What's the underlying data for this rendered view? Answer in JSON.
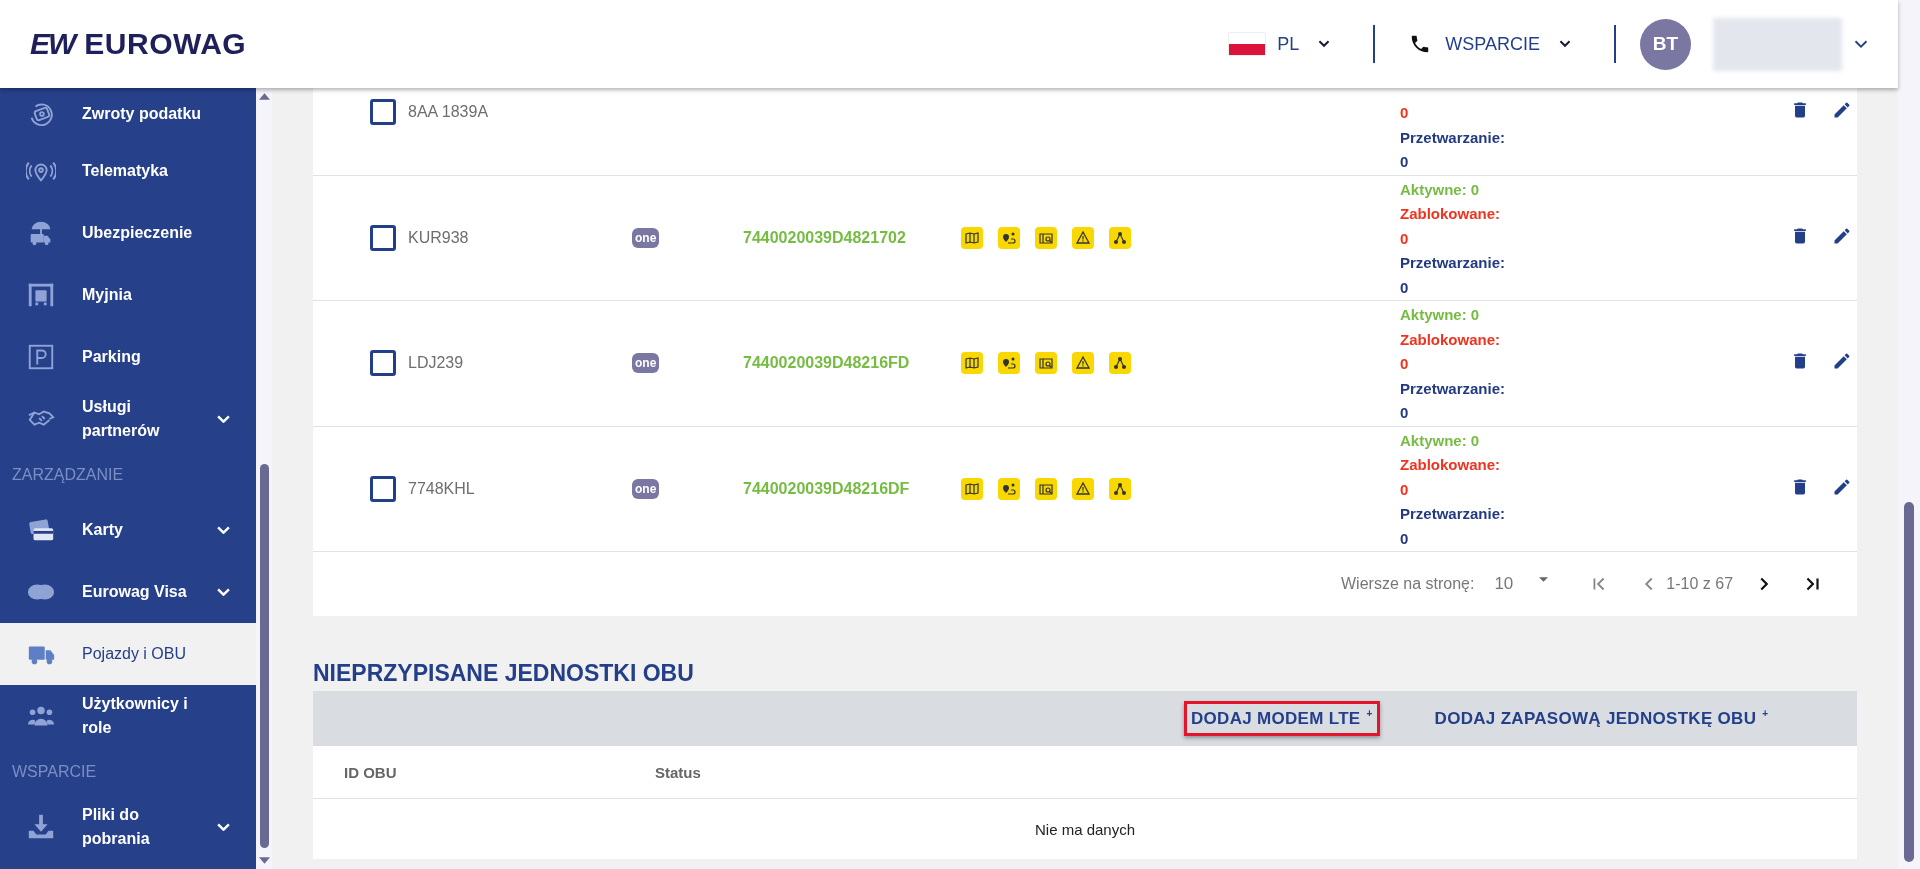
{
  "header": {
    "logo_mark": "EW",
    "logo_text": "EUROWAG",
    "language": "PL",
    "support": "WSPARCIE",
    "avatar_initials": "BT"
  },
  "sidebar": {
    "items": [
      {
        "kind": "item",
        "label": "Zwroty podatku",
        "expandable": false,
        "selected": false
      },
      {
        "kind": "item",
        "label": "Telematyka",
        "expandable": false,
        "selected": false
      },
      {
        "kind": "item",
        "label": "Ubezpieczenie",
        "expandable": false,
        "selected": false
      },
      {
        "kind": "item",
        "label": "Myjnia",
        "expandable": false,
        "selected": false
      },
      {
        "kind": "item",
        "label": "Parking",
        "expandable": false,
        "selected": false
      },
      {
        "kind": "item",
        "label": "Usługi partnerów",
        "expandable": true,
        "selected": false
      },
      {
        "kind": "section",
        "label": "ZARZĄDZANIE"
      },
      {
        "kind": "item",
        "label": "Karty",
        "expandable": true,
        "selected": false
      },
      {
        "kind": "item",
        "label": "Eurowag Visa",
        "expandable": true,
        "selected": false
      },
      {
        "kind": "item",
        "label": "Pojazdy i OBU",
        "expandable": false,
        "selected": true
      },
      {
        "kind": "item",
        "label": "Użytkownicy i role",
        "expandable": false,
        "selected": false
      },
      {
        "kind": "section",
        "label": "WSPARCIE"
      },
      {
        "kind": "item",
        "label": "Pliki do pobrania",
        "expandable": true,
        "selected": false
      }
    ]
  },
  "vehicles": {
    "rows": [
      {
        "checked": false,
        "plate": "8AA 1839A",
        "status_lines": [
          {
            "kind": "blocked",
            "text": "0"
          },
          {
            "kind": "processing",
            "text": "Przetwarzanie:"
          },
          {
            "kind": "processing",
            "text": "0"
          }
        ]
      },
      {
        "checked": false,
        "plate": "KUR938",
        "badge": "one",
        "obu_id": "7440020039D4821702",
        "services": [
          {
            "kind": "map"
          },
          {
            "kind": "route"
          },
          {
            "kind": "search"
          },
          {
            "kind": "warning"
          },
          {
            "kind": "network"
          }
        ],
        "status_lines": [
          {
            "kind": "active",
            "text": "Aktywne: 0"
          },
          {
            "kind": "blocked",
            "text": "Zablokowane:"
          },
          {
            "kind": "blocked",
            "text": "0"
          },
          {
            "kind": "processing",
            "text": "Przetwarzanie:"
          },
          {
            "kind": "processing",
            "text": "0"
          }
        ]
      },
      {
        "checked": false,
        "plate": "LDJ239",
        "badge": "one",
        "obu_id": "7440020039D48216FD",
        "services": [
          {
            "kind": "map"
          },
          {
            "kind": "route"
          },
          {
            "kind": "search"
          },
          {
            "kind": "warning"
          },
          {
            "kind": "network"
          }
        ],
        "status_lines": [
          {
            "kind": "active",
            "text": "Aktywne: 0"
          },
          {
            "kind": "blocked",
            "text": "Zablokowane:"
          },
          {
            "kind": "blocked",
            "text": "0"
          },
          {
            "kind": "processing",
            "text": "Przetwarzanie:"
          },
          {
            "kind": "processing",
            "text": "0"
          }
        ]
      },
      {
        "checked": false,
        "plate": "7748KHL",
        "badge": "one",
        "obu_id": "7440020039D48216DF",
        "services": [
          {
            "kind": "map"
          },
          {
            "kind": "route"
          },
          {
            "kind": "search"
          },
          {
            "kind": "warning"
          },
          {
            "kind": "network"
          }
        ],
        "status_lines": [
          {
            "kind": "active",
            "text": "Aktywne: 0"
          },
          {
            "kind": "blocked",
            "text": "Zablokowane:"
          },
          {
            "kind": "blocked",
            "text": "0"
          },
          {
            "kind": "processing",
            "text": "Przetwarzanie:"
          },
          {
            "kind": "processing",
            "text": "0"
          }
        ]
      }
    ],
    "pagination": {
      "rows_label": "Wiersze na stronę:",
      "rows_per_page": "10",
      "range": "1-10 z 67"
    }
  },
  "unassigned": {
    "title": "NIEPRZYPISANE JEDNOSTKI OBU",
    "actions": [
      {
        "label": "DODAJ MODEM LTE",
        "plus": "+",
        "highlighted": true
      },
      {
        "label": "DODAJ ZAPASOWĄ JEDNOSTKĘ OBU",
        "plus": "+",
        "highlighted": false
      }
    ],
    "columns": [
      "ID OBU",
      "Status"
    ],
    "empty": "Nie ma danych"
  }
}
